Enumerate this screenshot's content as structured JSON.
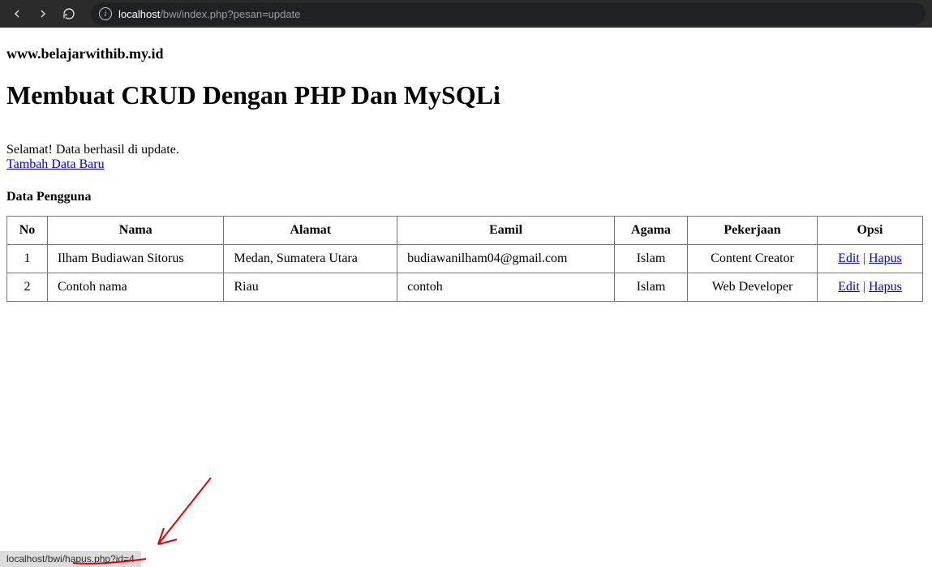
{
  "browser": {
    "url_origin": "localhost",
    "url_path": "/bwi/index.php?pesan=update",
    "hover_status": "localhost/bwi/hapus.php?id=4"
  },
  "header": {
    "site_title": "www.belajarwithib.my.id",
    "page_title": "Membuat CRUD Dengan PHP Dan MySQLi"
  },
  "message": "Selamat! Data berhasil di update.",
  "links": {
    "add_new": "Tambah Data Baru",
    "edit": "Edit",
    "delete": "Hapus"
  },
  "section_title": "Data Pengguna",
  "table": {
    "headers": {
      "no": "No",
      "nama": "Nama",
      "alamat": "Alamat",
      "email": "Eamil",
      "agama": "Agama",
      "pekerjaan": "Pekerjaan",
      "opsi": "Opsi"
    },
    "rows": [
      {
        "no": "1",
        "nama": "Ilham Budiawan Sitorus",
        "alamat": "Medan, Sumatera Utara",
        "email": "budiawanilham04@gmail.com",
        "agama": "Islam",
        "pekerjaan": "Content Creator"
      },
      {
        "no": "2",
        "nama": "Contoh nama",
        "alamat": "Riau",
        "email": "contoh",
        "agama": "Islam",
        "pekerjaan": "Web Developer"
      }
    ]
  }
}
